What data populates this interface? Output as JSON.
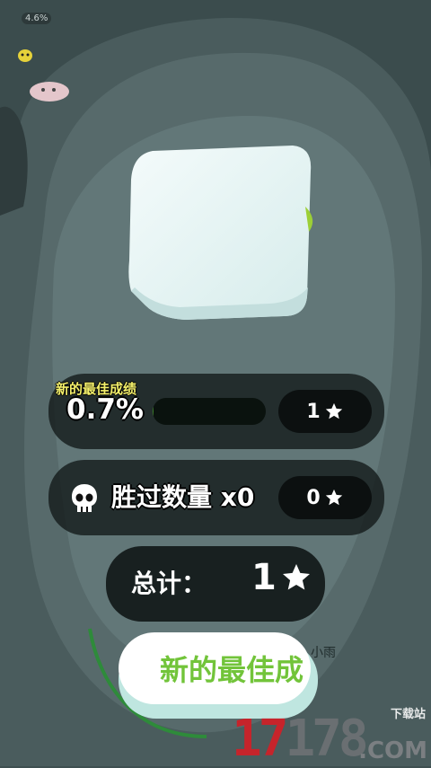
{
  "hud": {
    "percent_label": "4.6%"
  },
  "result": {
    "best_label": "新的最佳成绩",
    "best_value": "0.7%",
    "best_progress": 0.007,
    "best_stars": "1",
    "defeat_label": "胜过数量",
    "defeat_count": "x0",
    "defeat_stars": "0",
    "total_label": "总计：",
    "total_stars": "1"
  },
  "cta": {
    "label": "新的最佳成"
  },
  "player": {
    "name": "小雨"
  },
  "watermark": {
    "digits_gray_a": "17",
    "digit_red": "1",
    "digits_gray_b": "78",
    "domain": ".COM",
    "sub": "下载站"
  },
  "colors": {
    "accent_green": "#72c43a",
    "best_label_yellow": "#f3ef6a",
    "panel_dark": "#121818"
  },
  "icons": [
    "skull-icon",
    "star-icon"
  ]
}
